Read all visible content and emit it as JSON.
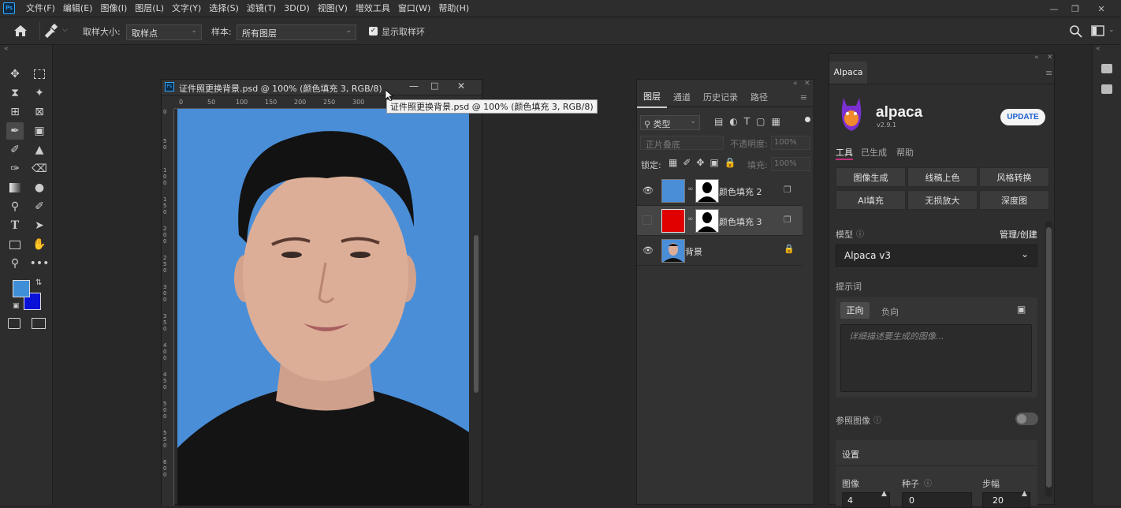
{
  "app": {
    "logo": "Ps"
  },
  "menu": [
    "文件(F)",
    "编辑(E)",
    "图像(I)",
    "图层(L)",
    "文字(Y)",
    "选择(S)",
    "滤镜(T)",
    "3D(D)",
    "视图(V)",
    "增效工具",
    "窗口(W)",
    "帮助(H)"
  ],
  "options": {
    "sample_size_label": "取样大小:",
    "sample_size_value": "取样点",
    "sample_label": "样本:",
    "sample_value": "所有图层",
    "show_ring_label": "显示取样环",
    "show_ring_checked": true
  },
  "document": {
    "title": "证件照更换背景.psd @ 100% (颜色填充 3, RGB/8)",
    "tooltip": "证件照更换背景.psd @ 100% (颜色填充 3, RGB/8)",
    "ruler_h": [
      "0",
      "50",
      "100",
      "150",
      "200",
      "250",
      "300"
    ],
    "ruler_v": [
      "0",
      "5 0",
      "1 0 0",
      "1 5 0",
      "2 0 0",
      "2 5 0",
      "3 0 0",
      "3 5 0",
      "4 0 0",
      "4 5 0",
      "5 0 0",
      "5 5 0",
      "6 0 0"
    ]
  },
  "colors": {
    "foreground": "#3f8fd8",
    "background": "#0a11d6",
    "canvas_bg": "#4a8ed8"
  },
  "layers_panel": {
    "tabs": [
      "图层",
      "通道",
      "历史记录",
      "路径"
    ],
    "filter_label": "类型",
    "blend_mode": "正片叠底",
    "opacity_label": "不透明度:",
    "opacity_value": "100%",
    "lock_label": "锁定:",
    "fill_label": "填充:",
    "fill_value": "100%",
    "layers": [
      {
        "name": "颜色填充 2",
        "visible": true,
        "color": "#4a8ed8"
      },
      {
        "name": "颜色填充 3",
        "visible": false,
        "color": "#e00000"
      },
      {
        "name": "背景",
        "visible": true,
        "locked": true
      }
    ]
  },
  "alpaca": {
    "panel_tab": "Alpaca",
    "brand": "alpaca",
    "version": "v2.9.1",
    "update_label": "UPDATE",
    "tabs": [
      "工具",
      "已生成",
      "帮助"
    ],
    "tools": [
      "图像生成",
      "线稿上色",
      "风格转换",
      "AI填充",
      "无损放大",
      "深度图"
    ],
    "model_label": "模型",
    "manage_label": "管理/创建",
    "model_value": "Alpaca v3",
    "prompt_label": "提示词",
    "prompt_tabs": [
      "正向",
      "负向"
    ],
    "prompt_placeholder": "详细描述要生成的图像...",
    "ref_image_label": "参照图像",
    "settings_label": "设置",
    "image_count_label": "图像",
    "image_count_value": "4",
    "seed_label": "种子",
    "seed_value": "0",
    "steps_label": "步幅",
    "steps_value": "20"
  }
}
